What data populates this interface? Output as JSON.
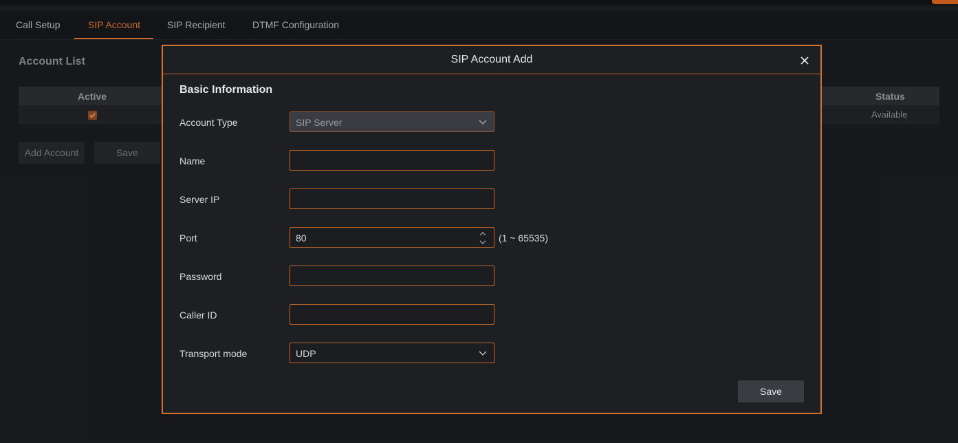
{
  "colors": {
    "accent": "#c96a2e",
    "modal_border": "#d0732f",
    "background": "#1a1b1e"
  },
  "tabs": [
    {
      "label": "Call Setup",
      "active": false
    },
    {
      "label": "SIP Account",
      "active": true
    },
    {
      "label": "SIP Recipient",
      "active": false
    },
    {
      "label": "DTMF Configuration",
      "active": false
    }
  ],
  "page": {
    "title": "Account List",
    "table": {
      "headers": {
        "active": "Active",
        "status": "Status"
      },
      "rows": [
        {
          "active": true,
          "status": "Available"
        }
      ]
    },
    "buttons": {
      "add": "Add Account",
      "save": "Save"
    }
  },
  "modal": {
    "title": "SIP Account Add",
    "close_icon": "close-icon",
    "section": "Basic Information",
    "fields": {
      "account_type": {
        "label": "Account Type",
        "value": "SIP Server",
        "disabled": true
      },
      "name": {
        "label": "Name",
        "value": ""
      },
      "server_ip": {
        "label": "Server IP",
        "value": ""
      },
      "port": {
        "label": "Port",
        "value": "80",
        "range": "(1 ~ 65535)"
      },
      "password": {
        "label": "Password",
        "value": ""
      },
      "caller_id": {
        "label": "Caller ID",
        "value": ""
      },
      "transport_mode": {
        "label": "Transport mode",
        "value": "UDP"
      }
    },
    "save_label": "Save"
  }
}
